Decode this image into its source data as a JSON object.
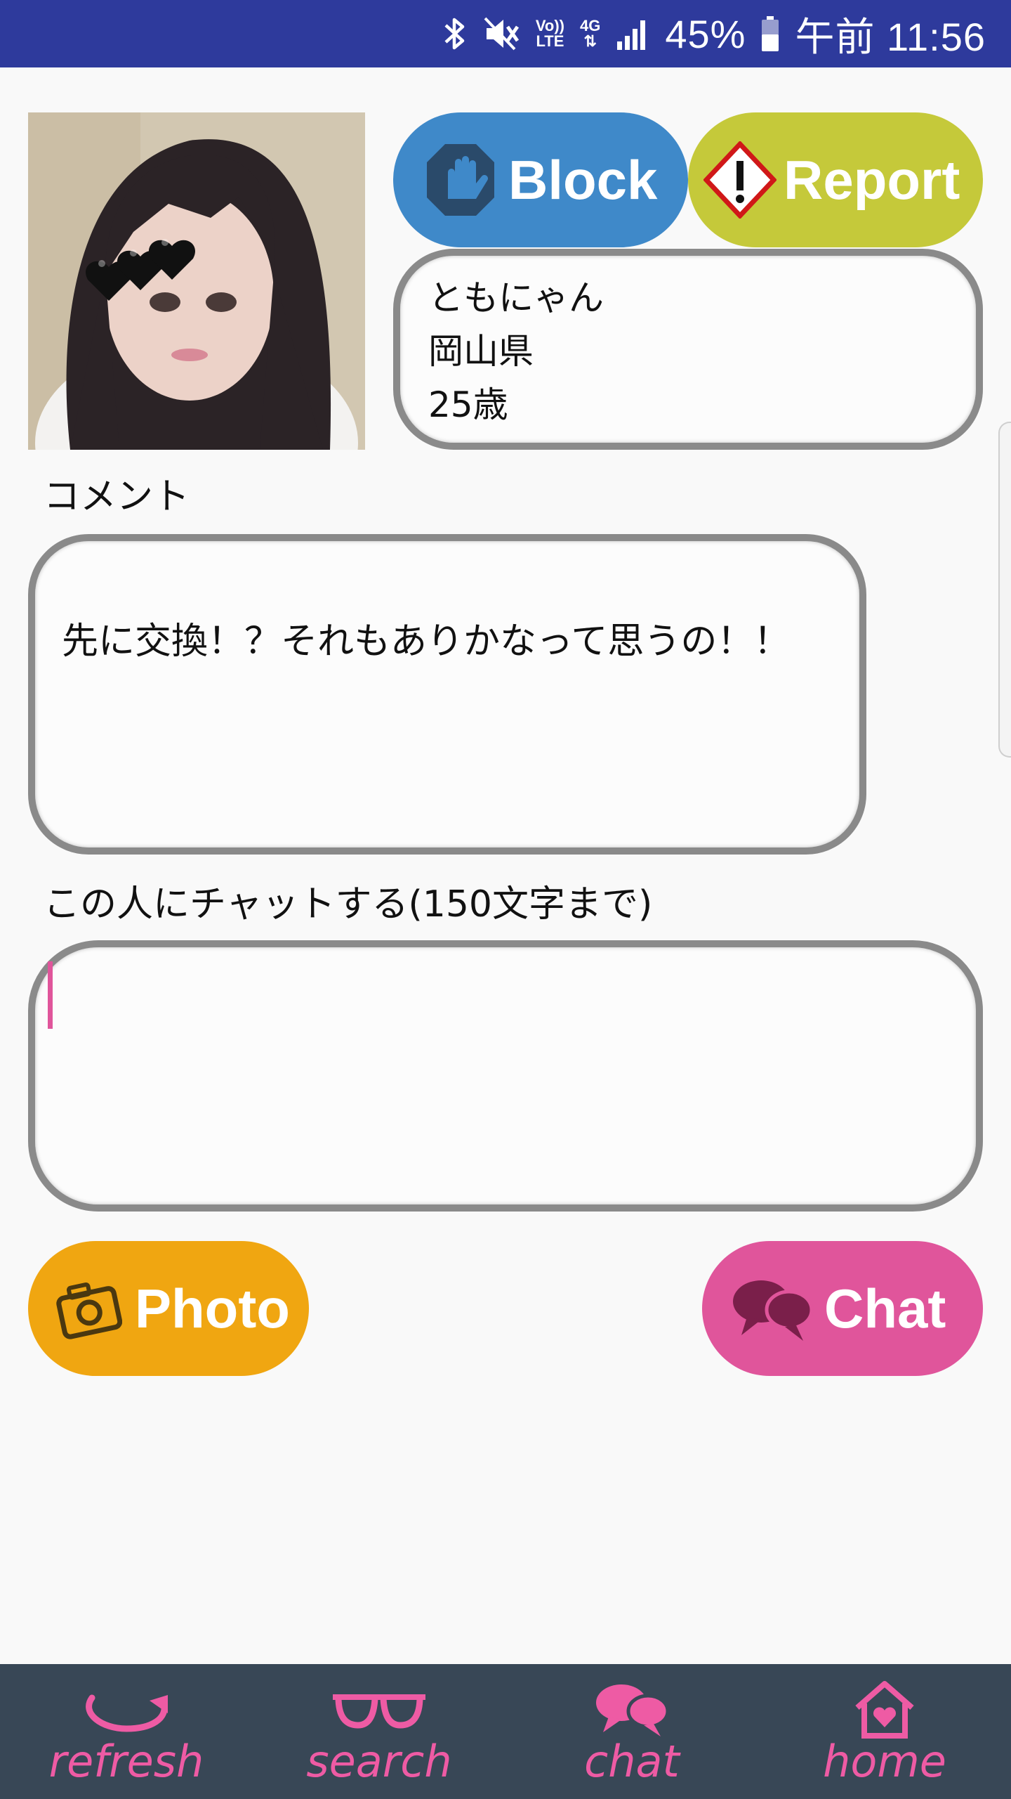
{
  "status_bar": {
    "lte_top": "Vo))",
    "lte_bottom": "LTE",
    "network": "4G",
    "battery": "45%",
    "time": "午前 11:56",
    "icons": [
      "bluetooth-icon",
      "mute-icon",
      "signal-icon",
      "battery-icon"
    ]
  },
  "profile": {
    "photo_alt": "profile-photo",
    "name": "ともにゃん",
    "prefecture": "岡山県",
    "age": "25歳"
  },
  "actions": {
    "block_label": "Block",
    "report_label": "Report"
  },
  "comment": {
    "label": "コメント",
    "text": "先に交換！？それもありかなって思うの！！"
  },
  "chat": {
    "label": "この人にチャットする(150文字まで)",
    "input_value": "",
    "photo_label": "Photo",
    "send_label": "Chat"
  },
  "nav": {
    "items": [
      {
        "label": "refresh",
        "icon": "refresh-icon"
      },
      {
        "label": "search",
        "icon": "glasses-icon"
      },
      {
        "label": "chat",
        "icon": "chat-bubbles-icon"
      },
      {
        "label": "home",
        "icon": "home-icon"
      }
    ]
  },
  "colors": {
    "status_bar": "#2e3a9c",
    "block": "#3f89c9",
    "report": "#c5c93a",
    "photo": "#f0a611",
    "chat": "#e0559b",
    "nav_bg": "#384756",
    "nav_accent": "#ee5ba4"
  }
}
